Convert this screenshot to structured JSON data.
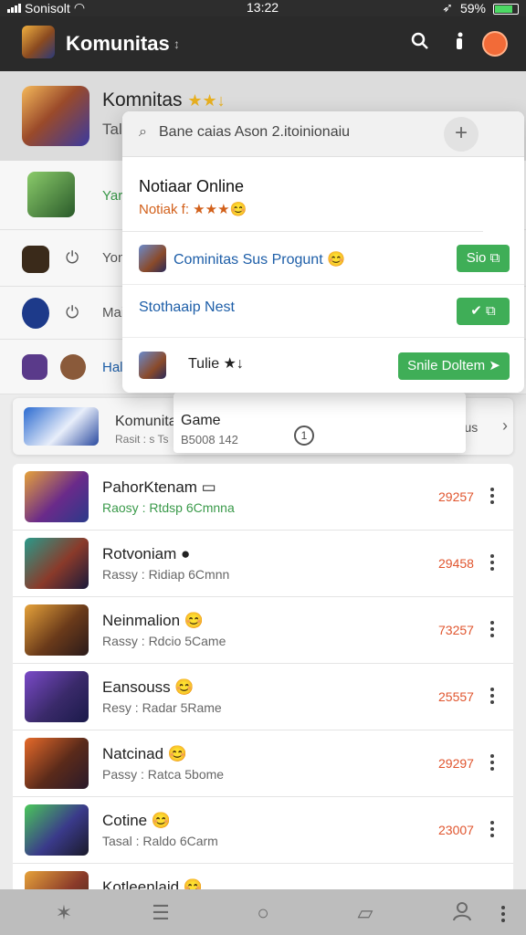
{
  "status_bar": {
    "carrier": "Sonisolt",
    "time": "13:22",
    "battery": "59%"
  },
  "app_bar": {
    "title": "Komunitas",
    "title_mark": "↕"
  },
  "community": {
    "name": "Komnitas",
    "badges": "★★↓",
    "subtitle": "Tal"
  },
  "bg_rows": [
    {
      "label": "Yar"
    },
    {
      "label": "Yon"
    },
    {
      "label": "Mai"
    },
    {
      "label": "Hal"
    }
  ],
  "popup": {
    "search_text": "Bane caias Ason 2.itoinionaiu",
    "header_title": "Notiaar Online",
    "header_sub": "Notiak f: ★★★😊",
    "rows": [
      {
        "label": "Cominitas Sus Progunt 😊",
        "button": "Sio ⧉"
      },
      {
        "label": "Stothaaip Nest",
        "button": "✔ ⧉"
      },
      {
        "label": "Tulie ★↓",
        "button": "Snile Doltem ➤"
      }
    ]
  },
  "featured": {
    "name": "Komunitas",
    "sub": "Rasit : s Ts",
    "right_label": "Tantus"
  },
  "sub_popup": {
    "title": "Game",
    "sub": "B5008 142",
    "info": "1"
  },
  "list_items": [
    {
      "name": "PahorKtenam ▭",
      "sub": "Raosy : Rtdsp 6Cmnna",
      "value": "29257",
      "colors": [
        "#e6a23a",
        "#6a2a8a",
        "#2a3a8a"
      ]
    },
    {
      "name": "Rotvoniam ●",
      "sub": "Rassy : Ridiap 6Cmnn",
      "value": "29458",
      "colors": [
        "#2a9a8a",
        "#8a3a2a",
        "#1a1a3a"
      ]
    },
    {
      "name": "Neinmalion 😊",
      "sub": "Rassy : Rdcio 5Came",
      "value": "73257",
      "colors": [
        "#e6a23a",
        "#6a3a1a",
        "#2a1a1a"
      ]
    },
    {
      "name": "Eansouss 😊",
      "sub": "Resy : Radar 5Rame",
      "value": "25557",
      "colors": [
        "#7a4ac8",
        "#3a2a6a",
        "#1a1a4a"
      ]
    },
    {
      "name": "Natcinad 😊",
      "sub": "Passy : Ratca 5bome",
      "value": "29297",
      "colors": [
        "#e66a2a",
        "#5a2a1a",
        "#2a1a2a"
      ]
    },
    {
      "name": "Cotine 😊",
      "sub": "Tasal : Raldo 6Carm",
      "value": "23007",
      "colors": [
        "#4ac85a",
        "#3a3a8a",
        "#1a1a2a"
      ]
    },
    {
      "name": "Kotleenlaid 😊",
      "sub": "",
      "value": "",
      "colors": [
        "#e6a23a",
        "#8a3a2a",
        "#3a2a1a"
      ]
    }
  ]
}
